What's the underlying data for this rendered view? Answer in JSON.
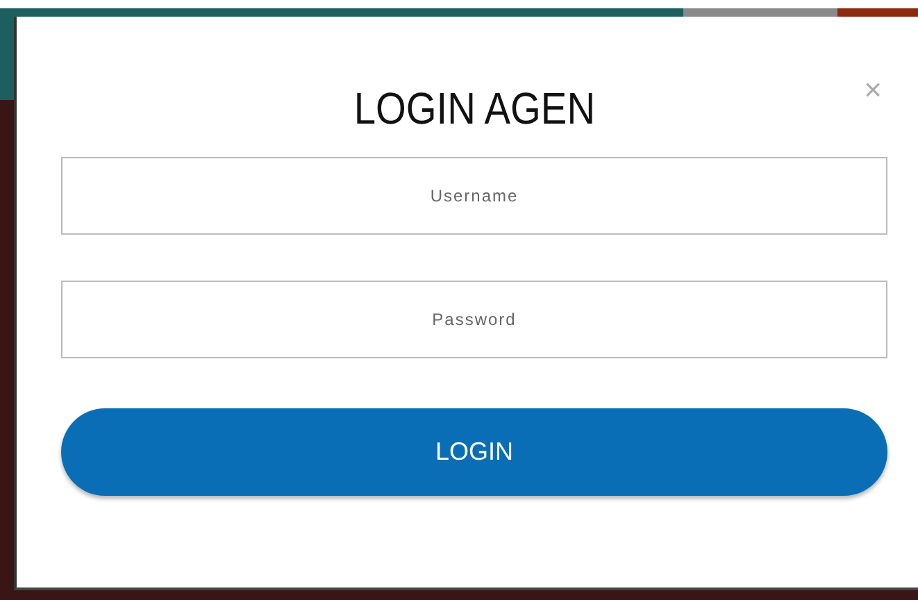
{
  "dialog": {
    "title": "LOGIN AGEN",
    "close": "×",
    "fields": [
      {
        "placeholder": "Username"
      },
      {
        "placeholder": "Password"
      }
    ],
    "button": "LOGIN"
  }
}
